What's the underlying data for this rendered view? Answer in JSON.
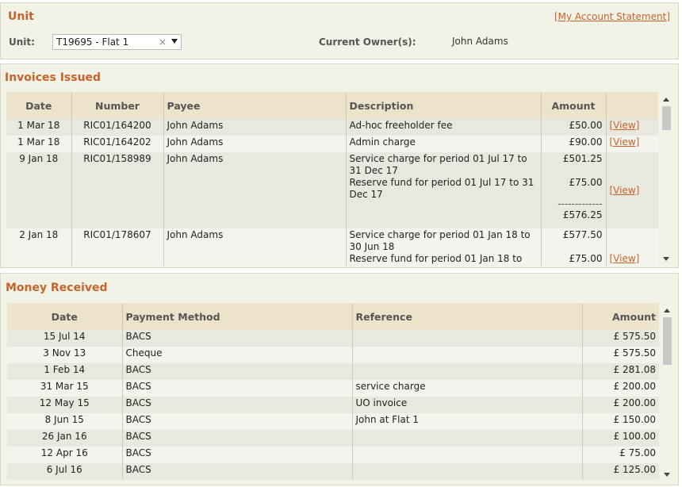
{
  "unit": {
    "title": "Unit",
    "statement_link": "[My Account Statement]",
    "unit_label": "Unit:",
    "unit_value": "T19695 - Flat 1",
    "clear_glyph": "×",
    "owner_label": "Current Owner(s):",
    "owner_value": "John Adams"
  },
  "invoices": {
    "title": "Invoices Issued",
    "headers": [
      "Date",
      "Number",
      "Payee",
      "Description",
      "Amount",
      ""
    ],
    "view_label": "[View]",
    "rows": [
      {
        "date": "1 Mar 18",
        "number": "RIC01/164200",
        "payee": "John Adams",
        "desc": [
          "Ad-hoc freeholder fee"
        ],
        "amounts": [
          "£50.00"
        ],
        "total": ""
      },
      {
        "date": "1 Mar 18",
        "number": "RIC01/164202",
        "payee": "John Adams",
        "desc": [
          "Admin charge"
        ],
        "amounts": [
          "£90.00"
        ],
        "total": ""
      },
      {
        "date": "9 Jan 18",
        "number": "RIC01/158989",
        "payee": "John Adams",
        "desc": [
          "Service charge for period 01 Jul 17 to 31 Dec 17",
          "Reserve fund for period 01 Jul 17 to 31 Dec 17"
        ],
        "amounts": [
          "£501.25",
          "£75.00"
        ],
        "separator": "-------------",
        "total": "£576.25"
      },
      {
        "date": "2 Jan 18",
        "number": "RIC01/178607",
        "payee": "John Adams",
        "desc": [
          "Service charge for period 01 Jan 18 to 30 Jun 18",
          "Reserve fund for period 01 Jan 18 to"
        ],
        "amounts": [
          "£577.50",
          "£75.00"
        ],
        "total": ""
      }
    ]
  },
  "money": {
    "title": "Money Received",
    "headers": [
      "Date",
      "Payment Method",
      "Reference",
      "Amount"
    ],
    "rows": [
      {
        "date": "15 Jul 14",
        "method": "BACS",
        "ref": "",
        "amount": "£ 575.50"
      },
      {
        "date": "3 Nov 13",
        "method": "Cheque",
        "ref": "",
        "amount": "£ 575.50"
      },
      {
        "date": "1 Feb 14",
        "method": "BACS",
        "ref": "",
        "amount": "£ 281.08"
      },
      {
        "date": "31 Mar 15",
        "method": "BACS",
        "ref": "service charge",
        "amount": "£ 200.00"
      },
      {
        "date": "12 May 15",
        "method": "BACS",
        "ref": "UO invoice",
        "amount": "£ 200.00"
      },
      {
        "date": "8 Jun 15",
        "method": "BACS",
        "ref": "John at Flat 1",
        "amount": "£ 150.00"
      },
      {
        "date": "26 Jan 16",
        "method": "BACS",
        "ref": "",
        "amount": "£ 100.00"
      },
      {
        "date": "12 Apr 16",
        "method": "BACS",
        "ref": "",
        "amount": "£ 75.00"
      },
      {
        "date": "6 Jul 16",
        "method": "BACS",
        "ref": "",
        "amount": "£ 125.00"
      }
    ]
  }
}
